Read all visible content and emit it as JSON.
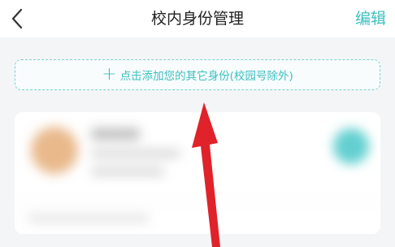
{
  "header": {
    "back_icon": "chevron-left-icon",
    "title": "校内身份管理",
    "edit_label": "编辑"
  },
  "add_identity": {
    "plus_icon": "plus-icon",
    "label": "点击添加您的其它身份(校园号除外)"
  },
  "colors": {
    "accent": "#3cbfc0",
    "arrow": "#e0222b",
    "background": "#f4f5f7"
  }
}
